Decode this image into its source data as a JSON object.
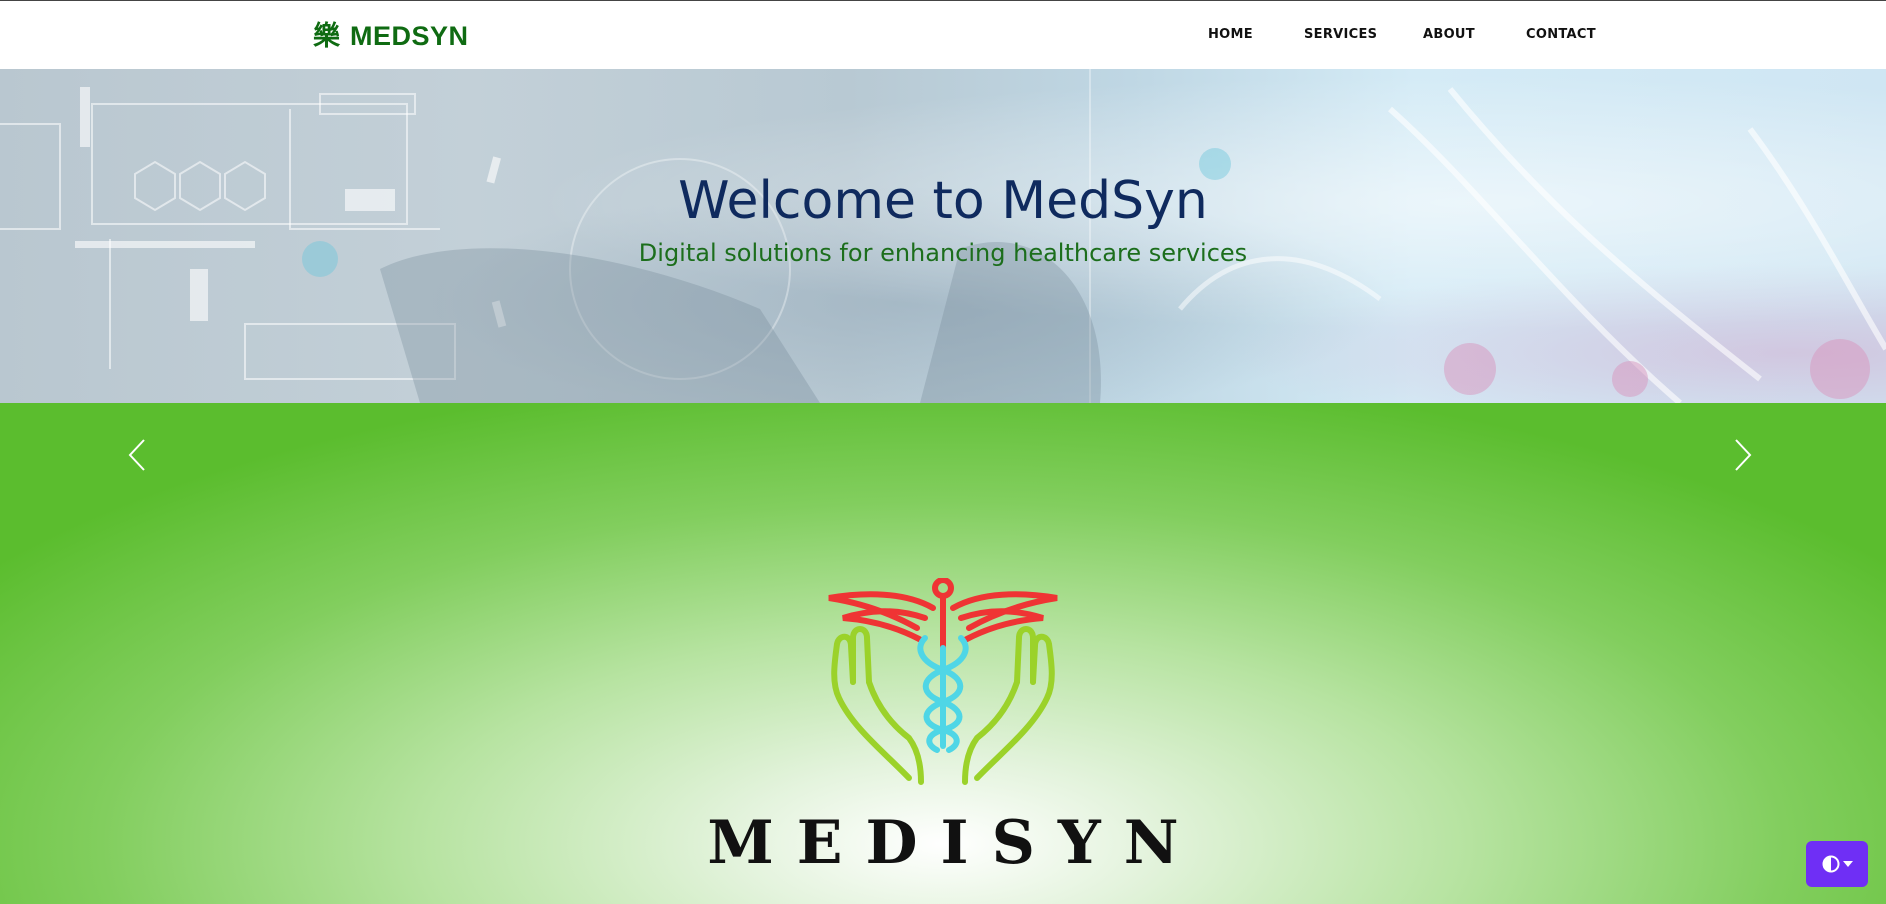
{
  "navbar": {
    "brand": {
      "icon": "樂",
      "name": "MEDSYN"
    },
    "links": [
      {
        "label": "HOME"
      },
      {
        "label": "SERVICES"
      },
      {
        "label": "ABOUT"
      },
      {
        "label": "CONTACT"
      }
    ]
  },
  "hero": {
    "title": "Welcome to MedSyn",
    "subtitle": "Digital solutions for enhancing healthcare services"
  },
  "carousel": {
    "prev_icon": "chevron-left-icon",
    "next_icon": "chevron-right-icon",
    "slide": {
      "logo_icon": "caduceus-hands-logo",
      "wordmark": "MEDISYN"
    }
  },
  "theme_toggle": {
    "icon": "contrast-icon",
    "dropdown_icon": "caret-down-icon",
    "color": "#6f2ff5"
  },
  "colors": {
    "brand": "#0f6b12",
    "hero_title": "#0f2a5e",
    "hero_subtitle": "#1c6e1c",
    "carousel_green": "#5bbd2e"
  }
}
